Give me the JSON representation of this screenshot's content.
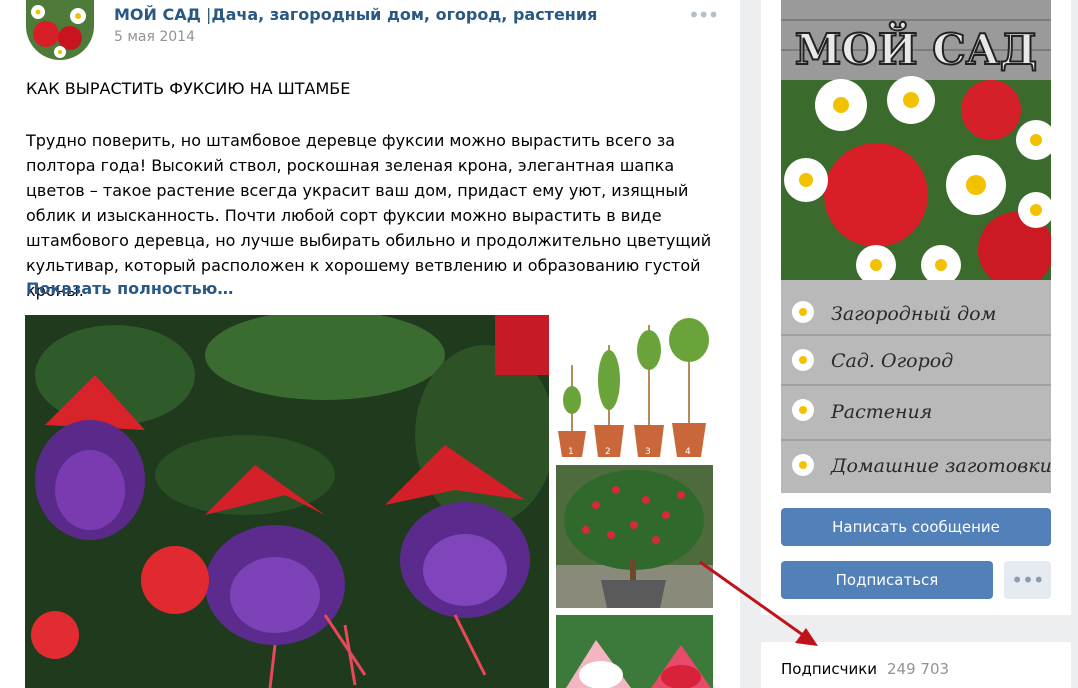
{
  "post": {
    "author": "МОЙ САД",
    "separator": " |",
    "author_desc": "Дача, загородный дом, огород, растения",
    "date": "5 мая 2014",
    "more_icon": "•••",
    "title": "КАК ВЫРАСТИТЬ ФУКСИЮ НА ШТАМБЕ",
    "text": "Трудно поверить, но штамбовое деревце фуксии можно вырастить всего за полтора года! Высокий ствол, роскошная зеленая крона, элегантная шапка цветов – такое растение всегда украсит ваш дом, придаст ему уют, изящный облик и изысканность. Почти любой сорт фуксии можно вырастить в виде штамбового деревца, но лучше выбирать обильно и продолжительно цветущий культивар, который расположен к хорошему ветвлению и образованию густой кроны.",
    "show_more": "Показать полностью…",
    "growth_steps": [
      "1",
      "2",
      "3",
      "4"
    ]
  },
  "sidebar": {
    "cover": {
      "title": "МОЙ САД",
      "items": [
        "Загородный дом",
        "Сад. Огород",
        "Растения",
        "Домашние заготовки"
      ]
    },
    "message_button": "Написать сообщение",
    "subscribe_button": "Подписаться",
    "more_button": "•••",
    "subscribers_label": "Подписчики",
    "subscribers_count": "249 703"
  },
  "colors": {
    "accent": "#5181b8",
    "link": "#2a5885",
    "background": "#edeef0",
    "arrow": "#c1121a"
  }
}
